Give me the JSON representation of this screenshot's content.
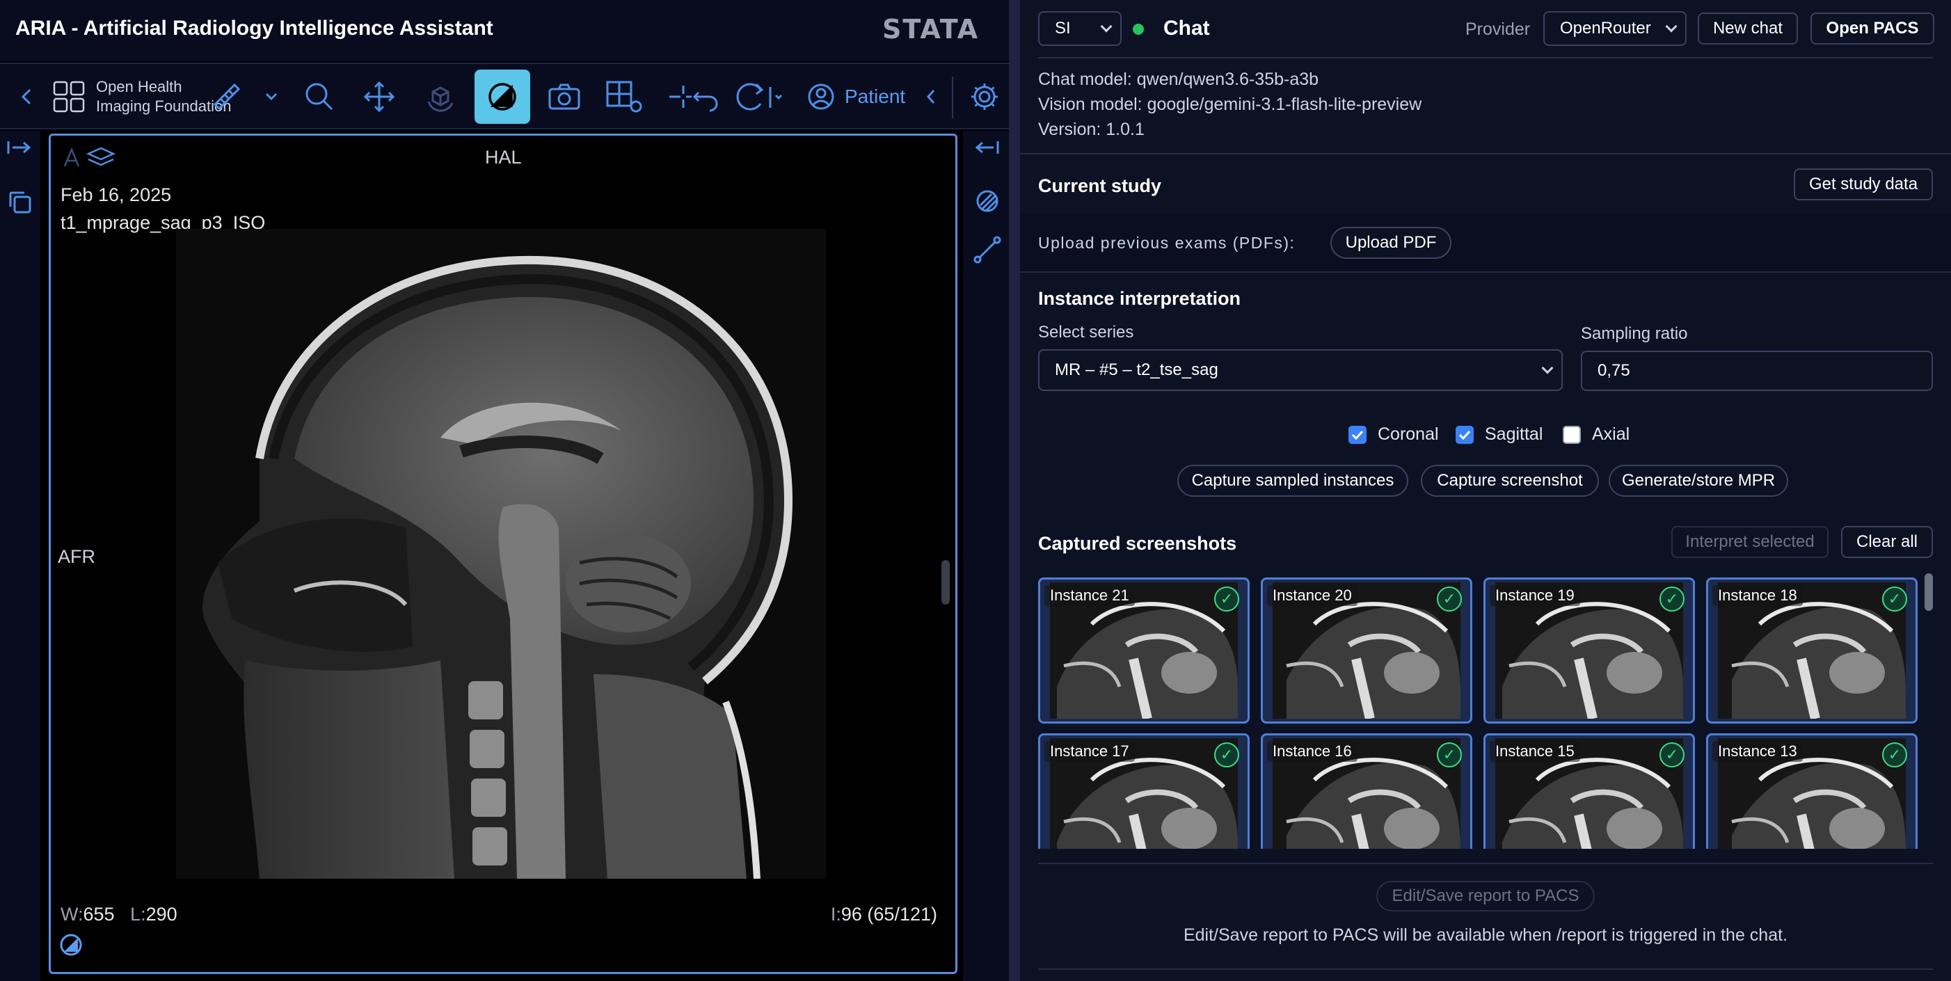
{
  "app": {
    "title": "ARIA - Artificial Radiology Intelligence Assistant",
    "vendor_logo": "STATA"
  },
  "toolbar": {
    "logo_line1": "Open Health",
    "logo_line2": "Imaging Foundation",
    "patient_label": "Patient",
    "active_tool": "contrast",
    "accent_color": "#5cc5ea"
  },
  "viewport": {
    "date": "Feb 16, 2025",
    "series_description": "t1_mprage_sag_p3_ISO",
    "orientation_top": "HAL",
    "orientation_left": "AFR",
    "window_label": "W:",
    "window_value": "655",
    "level_label": "L:",
    "level_value": "290",
    "index_label": "I:",
    "index_value": "96 (65/121)"
  },
  "panel": {
    "mode_select": "SI",
    "status_color": "#22c55e",
    "chat_title": "Chat",
    "provider_label": "Provider",
    "provider_value": "OpenRouter",
    "new_chat_label": "New chat",
    "open_pacs_label": "Open PACS",
    "chat_model": "Chat model: qwen/qwen3.6-35b-a3b",
    "vision_model": "Vision model: google/gemini-3.1-flash-lite-preview",
    "version": "Version: 1.0.1",
    "current_study_title": "Current study",
    "get_study_label": "Get study data",
    "upload_label": "Upload previous exams (PDFs):",
    "upload_button": "Upload PDF",
    "instance_title": "Instance interpretation",
    "select_series_label": "Select series",
    "select_series_value": "MR – #5 – t2_tse_sag",
    "sampling_ratio_label": "Sampling ratio",
    "sampling_ratio_value": "0,75",
    "checkboxes": [
      {
        "label": "Coronal",
        "checked": true
      },
      {
        "label": "Sagittal",
        "checked": true
      },
      {
        "label": "Axial",
        "checked": false
      }
    ],
    "capture_sampled_label": "Capture sampled instances",
    "capture_screenshot_label": "Capture screenshot",
    "generate_mpr_label": "Generate/store MPR",
    "captured_title": "Captured screenshots",
    "interpret_selected_label": "Interpret selected",
    "clear_all_label": "Clear all",
    "screenshots": [
      {
        "label": "Instance 21",
        "selected": true
      },
      {
        "label": "Instance 20",
        "selected": true
      },
      {
        "label": "Instance 19",
        "selected": true
      },
      {
        "label": "Instance 18",
        "selected": true
      },
      {
        "label": "Instance 17",
        "selected": true
      },
      {
        "label": "Instance 16",
        "selected": true
      },
      {
        "label": "Instance 15",
        "selected": true
      },
      {
        "label": "Instance 13",
        "selected": true
      }
    ],
    "edit_save_label": "Edit/Save report to PACS",
    "edit_save_note": "Edit/Save report to PACS will be available when /report is triggered in the chat."
  }
}
